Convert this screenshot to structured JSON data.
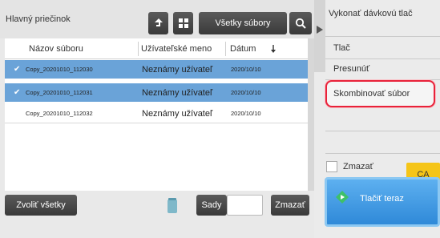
{
  "folder": {
    "label": "Hlavný priečinok"
  },
  "toolbar": {
    "all_files_label": "Všetky súbory"
  },
  "table": {
    "headers": [
      "Názov súboru",
      "Užívateľské meno",
      "Dátum"
    ],
    "rows": [
      {
        "name": "Copy_20201010_112030",
        "user": "Neznámy užívateľ",
        "date": "2020/10/10",
        "selected": true
      },
      {
        "name": "Copy_20201010_112031",
        "user": "Neznámy užívateľ",
        "date": "2020/10/10",
        "selected": true
      },
      {
        "name": "Copy_20201010_112032",
        "user": "Neznámy užívateľ",
        "date": "2020/10/10",
        "selected": false
      }
    ]
  },
  "bottom": {
    "select_all_label": "Zvoliť všetky",
    "sets_label": "Sady",
    "delete_label": "Zmazať"
  },
  "actions": {
    "items": [
      "Vykonať dávkovú tlač",
      "Tlač",
      "Presunúť",
      "Skombinovať súbor"
    ]
  },
  "right": {
    "delete_label": "Zmazať",
    "ca_label": "CA",
    "print_label": "Tlačiť teraz"
  },
  "colors": {
    "selected_row": "#6aa3d8",
    "highlight": "#e8223a",
    "ca_button": "#f5c518",
    "print_button": "#2f89d8"
  }
}
